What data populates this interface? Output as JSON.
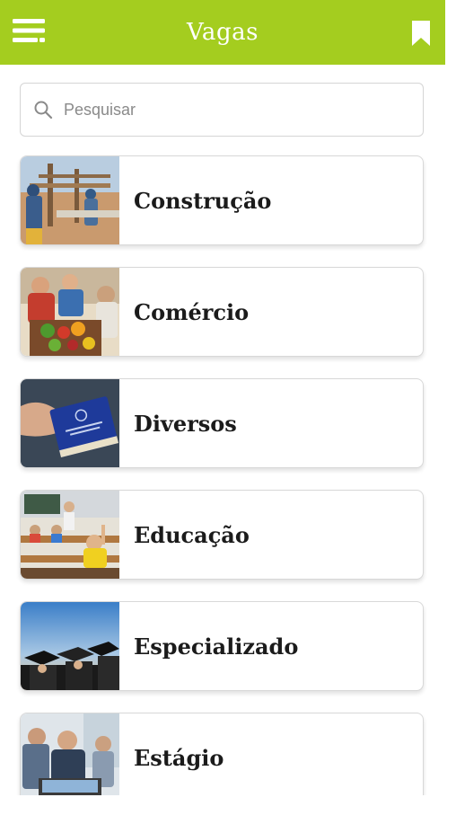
{
  "appbar": {
    "title": "Vagas",
    "menu_icon": "menu-icon",
    "bookmark_icon": "bookmark-icon",
    "color": "#a4cd1f"
  },
  "search": {
    "placeholder": "Pesquisar",
    "value": "",
    "icon": "search-icon"
  },
  "categories": [
    {
      "label": "Construção",
      "image": "construction-workers-photo"
    },
    {
      "label": "Comércio",
      "image": "market-vegetables-photo"
    },
    {
      "label": "Diversos",
      "image": "work-card-photo"
    },
    {
      "label": "Educação",
      "image": "classroom-photo"
    },
    {
      "label": "Especializado",
      "image": "graduation-caps-photo"
    },
    {
      "label": "Estágio",
      "image": "office-team-photo"
    }
  ]
}
